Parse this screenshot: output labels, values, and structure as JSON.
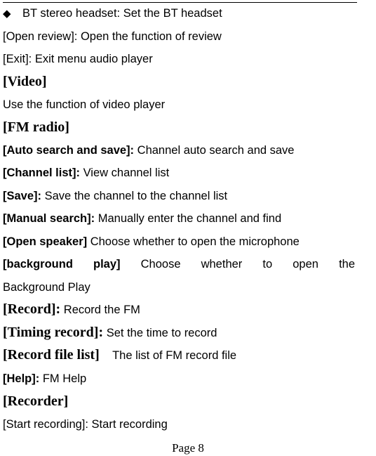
{
  "document": {
    "bullet_item": {
      "icon": "black-diamond",
      "glyph": "◆",
      "text": "BT stereo headset: Set the BT headset"
    },
    "audio_items": [
      {
        "text": "[Open review]: Open the function of review"
      },
      {
        "text": "[Exit]: Exit menu audio player"
      }
    ],
    "video": {
      "heading": "[Video]",
      "description": "Use the function of video player"
    },
    "fm_radio": {
      "heading": "[FM radio]",
      "items": [
        {
          "term": "[Auto search and save]:",
          "desc": "Channel auto search and save"
        },
        {
          "term": "[Channel list]:",
          "desc": "View channel list"
        },
        {
          "term": "[Save]:",
          "desc": "Save the channel to the channel list"
        },
        {
          "term": "[Manual search]:",
          "desc": "Manually enter the channel and find"
        },
        {
          "term": "[Open speaker]",
          "desc": "Choose whether to open the microphone"
        }
      ],
      "background_play": {
        "words": [
          "[background",
          "play]",
          "Choose",
          "whether",
          "to",
          "open",
          "the"
        ],
        "continuation": "Background Play"
      },
      "serif_items": [
        {
          "term": "[Record]:",
          "desc": "Record the FM"
        },
        {
          "term": "[Timing record]:",
          "desc": "Set the time to record"
        },
        {
          "term": "[Record file list]",
          "desc": "The list of FM record file"
        }
      ],
      "help": {
        "term": "[Help]:",
        "desc": "FM Help"
      }
    },
    "recorder": {
      "heading": "[Recorder]",
      "items": [
        {
          "text": "[Start recording]: Start recording"
        }
      ]
    },
    "footer": {
      "page_label": "Page 8"
    }
  }
}
